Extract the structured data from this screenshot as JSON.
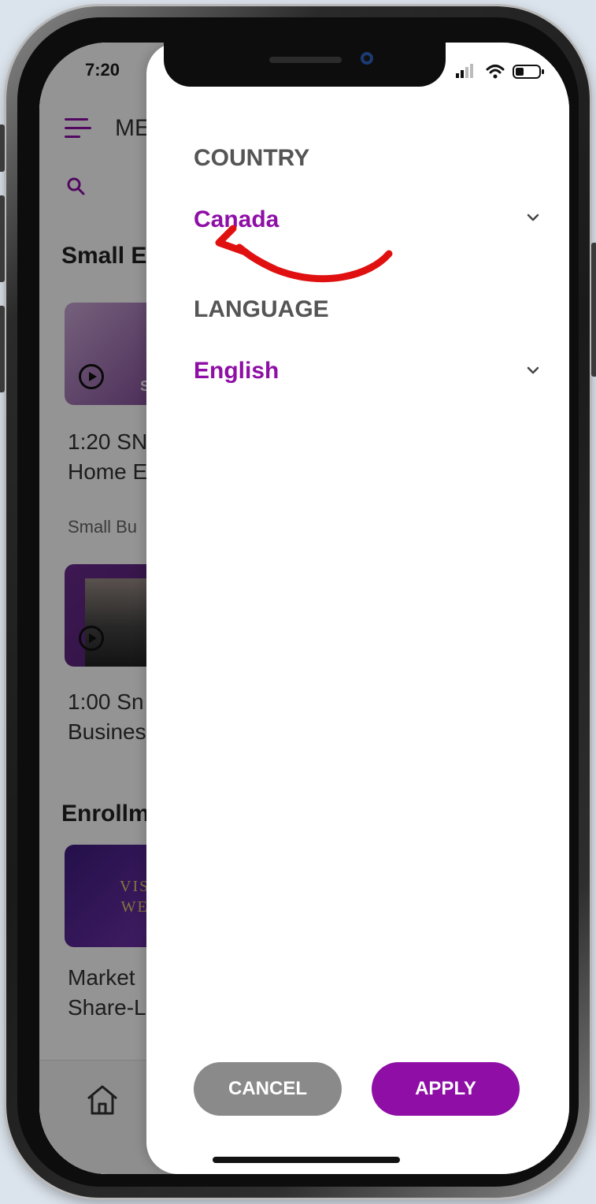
{
  "status_bar": {
    "time": "7:20"
  },
  "background_app": {
    "header_title": "ME",
    "sections": [
      "Small E",
      "Enrollm"
    ],
    "items": [
      {
        "title_line1": "1:20 SN",
        "title_line2": "Home E",
        "subtitle": "Small Bu",
        "thumb_badge": "S"
      },
      {
        "title_line1": "1:00 Sn",
        "title_line2": "Busines"
      },
      {
        "title_line1": "Market",
        "title_line2": "Share-L",
        "thumb_text_line1": "VIS",
        "thumb_text_line2": "WE"
      }
    ]
  },
  "drawer": {
    "country_label": "COUNTRY",
    "country_value": "Canada",
    "language_label": "LANGUAGE",
    "language_value": "English",
    "cancel_label": "CANCEL",
    "apply_label": "APPLY"
  },
  "colors": {
    "accent": "#8e0ea6",
    "cancel_button": "#8a8a8a",
    "arrow": "#e01010"
  },
  "icons": [
    "menu-icon",
    "search-icon",
    "play-icon",
    "home-icon",
    "chevron-down-icon",
    "signal-icon",
    "wifi-icon",
    "battery-icon"
  ]
}
